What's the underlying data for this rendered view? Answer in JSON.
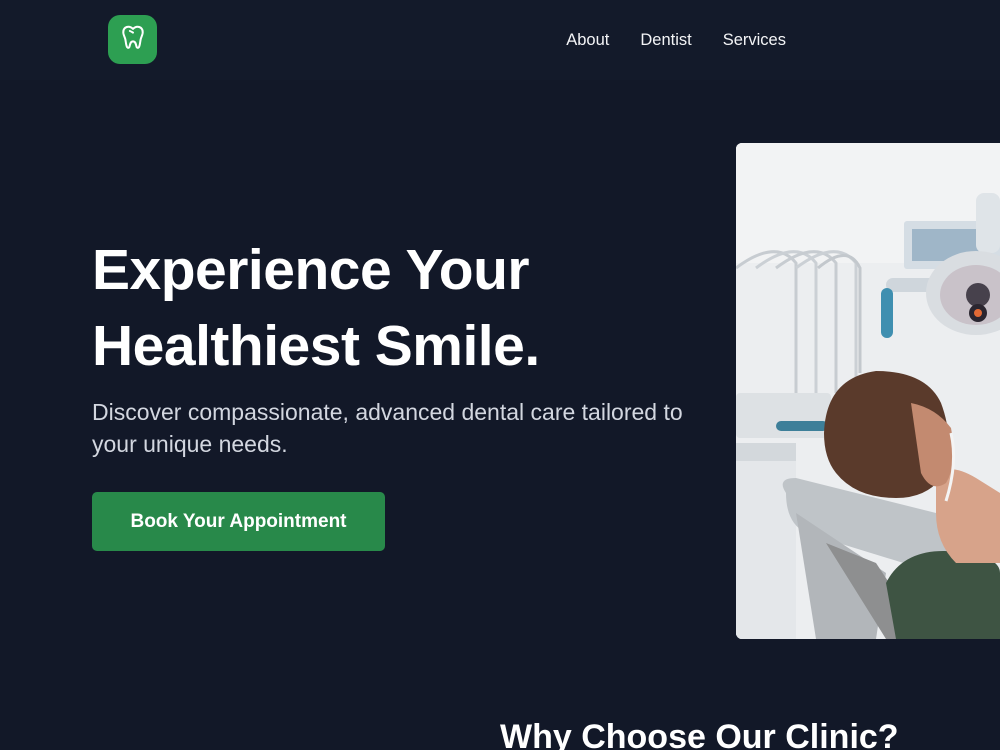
{
  "header": {
    "logo_icon": "tooth-icon",
    "nav": [
      {
        "label": "About"
      },
      {
        "label": "Dentist"
      },
      {
        "label": "Services"
      }
    ]
  },
  "hero": {
    "title_line1": "Experience Your",
    "title_line2": "Healthiest Smile.",
    "subtitle": "Discover compassionate, advanced dental care tailored to your unique needs.",
    "cta_label": "Book Your Appointment",
    "image_icon": "dental-patient-photo"
  },
  "section": {
    "title": "Why Choose Our Clinic?"
  },
  "colors": {
    "background": "#121828",
    "accent": "#28894a",
    "logo": "#2d9f52"
  }
}
